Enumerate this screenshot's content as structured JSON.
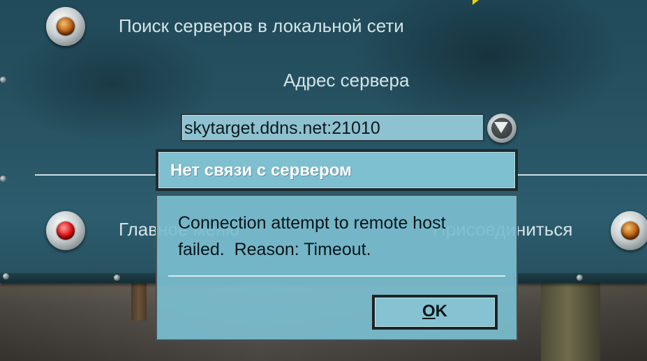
{
  "lan_search": {
    "label": "Поиск серверов в локальной сети",
    "lamp_color": "#b0560e"
  },
  "address": {
    "label": "Адрес сервера",
    "value": "skytarget.ddns.net:21010"
  },
  "main_menu": {
    "label": "Главное меню",
    "lamp_color": "#e01010"
  },
  "join": {
    "label": "Присоединиться",
    "lamp_color": "#b0560e"
  },
  "dialog": {
    "title": "Нет связи с сервером",
    "message": "Connection attempt to remote host failed.  Reason: Timeout.",
    "ok_underlined": "O",
    "ok_rest": "K"
  },
  "colors": {
    "panel": "#285464",
    "dialog_bg": "#7abdcf",
    "input_bg": "#8fc2d0",
    "cursor_arrow": "#f2d000"
  },
  "icons": [
    "amber-lamp-icon",
    "red-lamp-icon",
    "dropdown-arrow-icon",
    "cursor-arrow-icon"
  ]
}
